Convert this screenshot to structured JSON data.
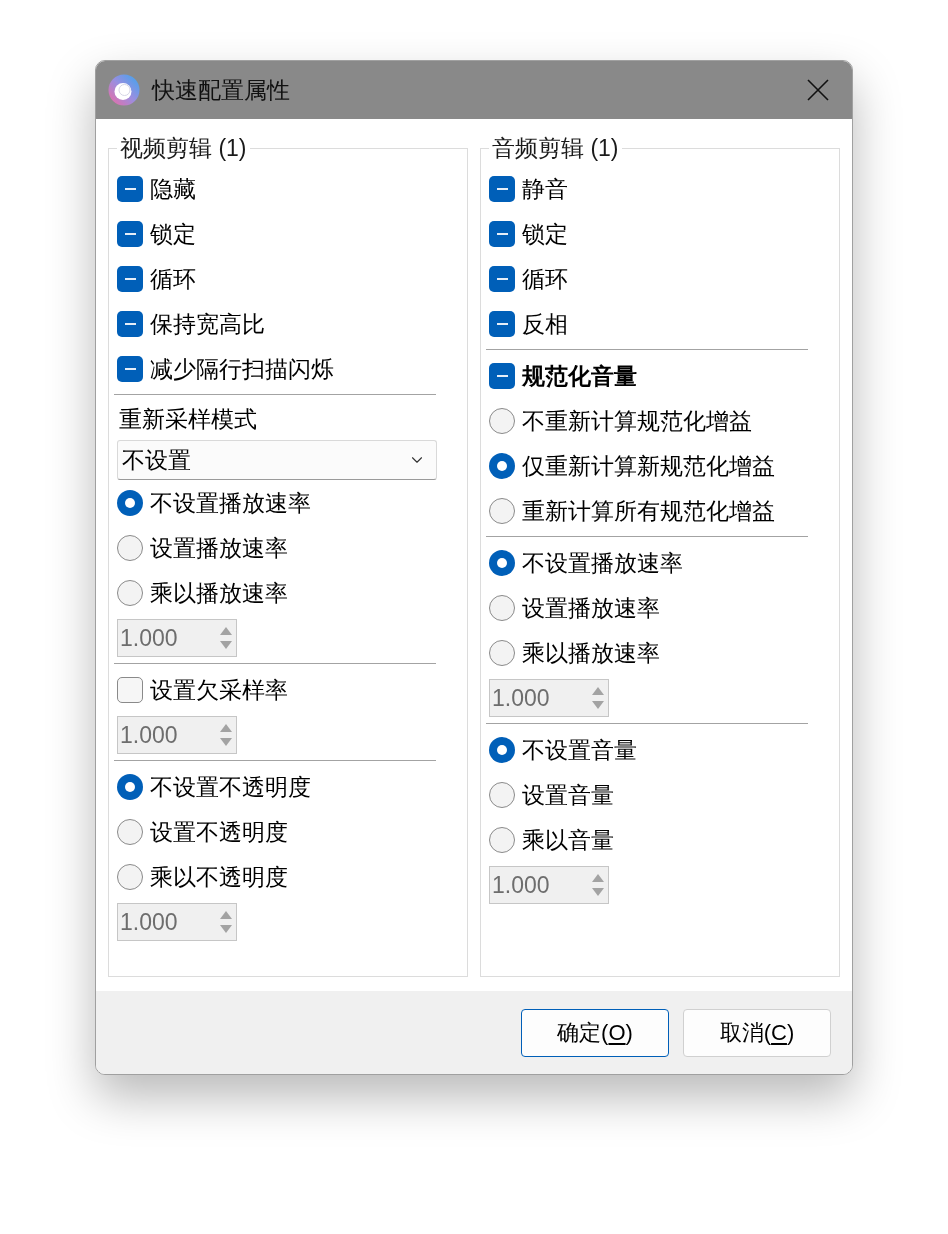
{
  "window": {
    "title": "快速配置属性"
  },
  "groups": [
    {
      "title": "视频剪辑 (1)",
      "items": [
        {
          "kind": "checkbox",
          "label": "隐藏",
          "indeterminate": true,
          "bold": false
        },
        {
          "kind": "checkbox",
          "label": "锁定",
          "indeterminate": true,
          "bold": false
        },
        {
          "kind": "checkbox",
          "label": "循环",
          "indeterminate": true,
          "bold": false
        },
        {
          "kind": "checkbox",
          "label": "保持宽高比",
          "indeterminate": true,
          "bold": false
        },
        {
          "kind": "checkbox",
          "label": "减少隔行扫描闪烁",
          "indeterminate": true,
          "bold": false
        },
        {
          "kind": "separator"
        },
        {
          "kind": "label",
          "text": "重新采样模式"
        },
        {
          "kind": "dropdown",
          "value": "不设置"
        },
        {
          "kind": "radio",
          "label": "不设置播放速率",
          "selected": true
        },
        {
          "kind": "radio",
          "label": "设置播放速率",
          "selected": false
        },
        {
          "kind": "radio",
          "label": "乘以播放速率",
          "selected": false
        },
        {
          "kind": "spinbox",
          "value": "1.000",
          "disabled": true
        },
        {
          "kind": "separator"
        },
        {
          "kind": "checkbox",
          "label": "设置欠采样率",
          "checked": false,
          "indeterminate": false,
          "bold": false
        },
        {
          "kind": "spinbox",
          "value": "1.000",
          "disabled": true
        },
        {
          "kind": "separator"
        },
        {
          "kind": "radio",
          "label": "不设置不透明度",
          "selected": true
        },
        {
          "kind": "radio",
          "label": "设置不透明度",
          "selected": false
        },
        {
          "kind": "radio",
          "label": "乘以不透明度",
          "selected": false
        },
        {
          "kind": "spinbox",
          "value": "1.000",
          "disabled": true
        }
      ]
    },
    {
      "title": "音频剪辑 (1)",
      "items": [
        {
          "kind": "checkbox",
          "label": "静音",
          "indeterminate": true,
          "bold": false
        },
        {
          "kind": "checkbox",
          "label": "锁定",
          "indeterminate": true,
          "bold": false
        },
        {
          "kind": "checkbox",
          "label": "循环",
          "indeterminate": true,
          "bold": false
        },
        {
          "kind": "checkbox",
          "label": "反相",
          "indeterminate": true,
          "bold": false
        },
        {
          "kind": "separator"
        },
        {
          "kind": "checkbox",
          "label": "规范化音量",
          "indeterminate": true,
          "bold": true
        },
        {
          "kind": "radio",
          "label": "不重新计算规范化增益",
          "selected": false
        },
        {
          "kind": "radio",
          "label": "仅重新计算新规范化增益",
          "selected": true
        },
        {
          "kind": "radio",
          "label": "重新计算所有规范化增益",
          "selected": false
        },
        {
          "kind": "separator"
        },
        {
          "kind": "radio",
          "label": "不设置播放速率",
          "selected": true
        },
        {
          "kind": "radio",
          "label": "设置播放速率",
          "selected": false
        },
        {
          "kind": "radio",
          "label": "乘以播放速率",
          "selected": false
        },
        {
          "kind": "spinbox",
          "value": "1.000",
          "disabled": true
        },
        {
          "kind": "separator"
        },
        {
          "kind": "radio",
          "label": "不设置音量",
          "selected": true
        },
        {
          "kind": "radio",
          "label": "设置音量",
          "selected": false
        },
        {
          "kind": "radio",
          "label": "乘以音量",
          "selected": false
        },
        {
          "kind": "spinbox",
          "value": "1.000",
          "disabled": true
        }
      ]
    }
  ],
  "buttons": [
    {
      "text": "确定(",
      "access_key": "O",
      "text_end": ")",
      "default": true
    },
    {
      "text": "取消(",
      "access_key": "C",
      "text_end": ")",
      "default": false
    }
  ]
}
